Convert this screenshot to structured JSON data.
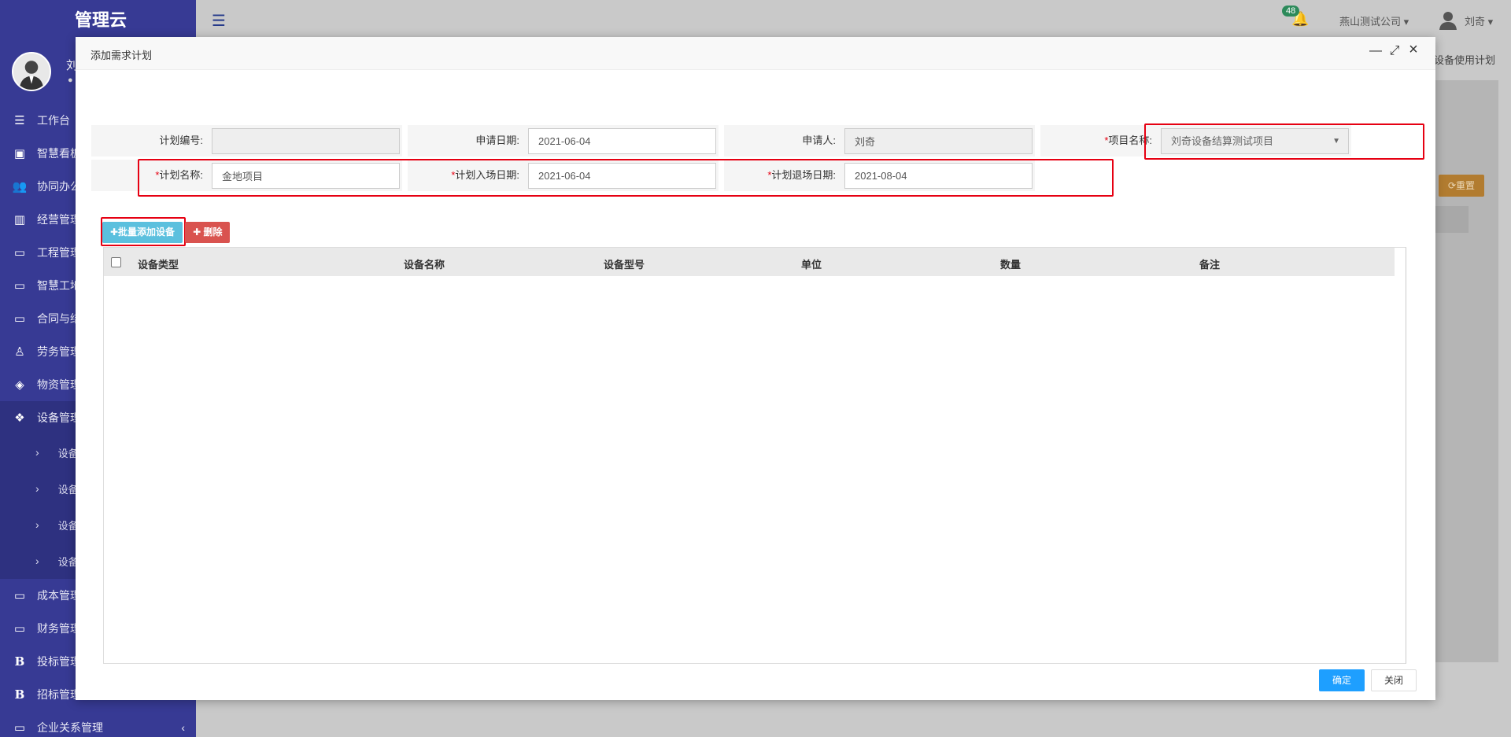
{
  "sidebar": {
    "brand": "管理云",
    "profile_name": "刘",
    "profile_status": "●",
    "items": [
      {
        "label": "工作台",
        "icon": "list-icon"
      },
      {
        "label": "智慧看板",
        "icon": "dashboard-icon"
      },
      {
        "label": "协同办公",
        "icon": "users-icon"
      },
      {
        "label": "经营管理",
        "icon": "bar-chart-icon"
      },
      {
        "label": "工程管理",
        "icon": "monitor-icon"
      },
      {
        "label": "智慧工地",
        "icon": "monitor-icon"
      },
      {
        "label": "合同与结",
        "icon": "monitor-icon"
      },
      {
        "label": "劳务管理",
        "icon": "worker-icon"
      },
      {
        "label": "物资管理",
        "icon": "box-icon"
      },
      {
        "label": "设备管理",
        "icon": "cubes-icon"
      }
    ],
    "sub_items": [
      "设备",
      "设备",
      "设备",
      "设备"
    ],
    "items_after": [
      {
        "label": "成本管理",
        "icon": "monitor-icon"
      },
      {
        "label": "财务管理",
        "icon": "monitor-icon"
      },
      {
        "label": "投标管理",
        "icon": "bold-b-icon"
      },
      {
        "label": "招标管理",
        "icon": "bold-b-icon"
      },
      {
        "label": "企业关系管理",
        "icon": "monitor-icon"
      }
    ]
  },
  "topbar": {
    "badge_count": "48",
    "company": "燕山测试公司",
    "user_name": "刘奇"
  },
  "background": {
    "tab_label": "设备使用计划",
    "reset_label": "重置"
  },
  "modal": {
    "title": "添加需求计划",
    "form": {
      "plan_no_label": "计划编号:",
      "plan_no_value": "",
      "apply_date_label": "申请日期:",
      "apply_date_value": "2021-06-04",
      "applicant_label": "申请人:",
      "applicant_value": "刘奇",
      "project_label": "项目名称:",
      "project_value": "刘奇设备结算测试项目",
      "plan_name_label": "计划名称:",
      "plan_name_value": "金地项目",
      "entry_date_label": "计划入场日期:",
      "entry_date_value": "2021-06-04",
      "exit_date_label": "计划退场日期:",
      "exit_date_value": "2021-08-04",
      "required_mark": "*"
    },
    "toolbar": {
      "batch_add_label": "✚批量添加设备",
      "delete_label": "✚ 删除"
    },
    "table": {
      "columns": [
        "设备类型",
        "设备名称",
        "设备型号",
        "单位",
        "数量",
        "备注"
      ]
    },
    "footer": {
      "ok_label": "确定",
      "close_label": "关闭"
    }
  },
  "colors": {
    "sidebar_bg": "#373a94",
    "highlight": "#e60012",
    "primary_info": "#5bc0de",
    "danger": "#d9534f",
    "ok_button": "#1e9fff"
  }
}
